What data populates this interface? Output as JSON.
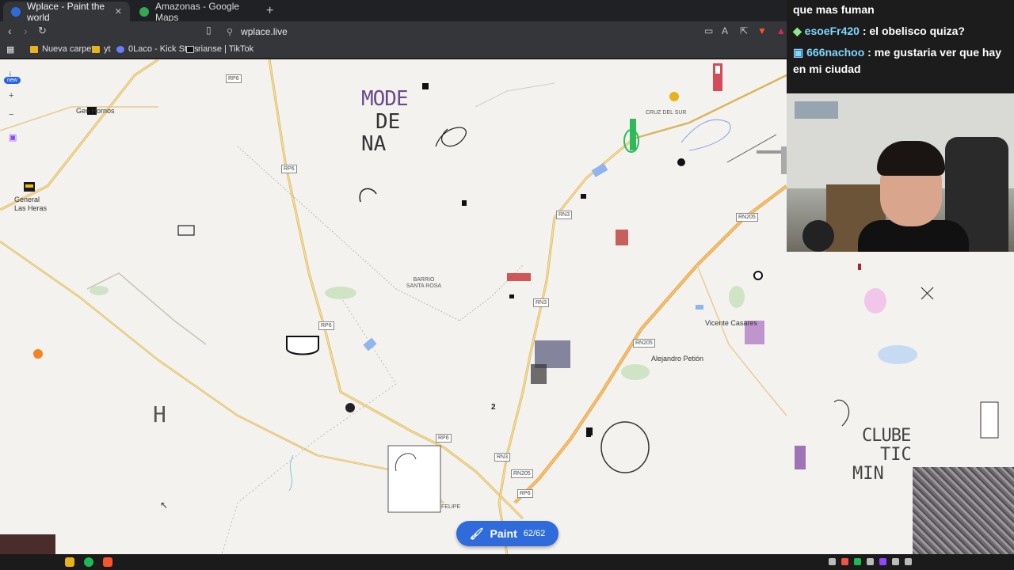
{
  "browser": {
    "tabs": [
      {
        "title": "Wplace - Paint the world",
        "active": true
      },
      {
        "title": "Amazonas - Google Maps",
        "active": false
      }
    ],
    "url": "wplace.live",
    "bookmarks": [
      {
        "label": "Nueva carpeta"
      },
      {
        "label": "yt"
      },
      {
        "label": "0Laco - Kick Stats"
      },
      {
        "label": "rianse | TikTok"
      }
    ]
  },
  "map": {
    "new_badge": "new",
    "road_labels": [
      "RP6",
      "RP6",
      "RP6",
      "RP6",
      "RP6",
      "RP6",
      "RN3",
      "RN3",
      "RN3",
      "RN205",
      "RN205",
      "RN205",
      "RN3"
    ],
    "places": {
      "general_hornos": "Gen Hornos",
      "general_las_heras": "General Las Heras",
      "barrio_santa_rosa": "BARRIO SANTA ROSA",
      "vicente_casares": "Vicente Casares",
      "alejandro_petion": "Alejandro Petión",
      "cruz_del_sur": "CRUZ DEL SUR",
      "felipe": "FELIPE"
    },
    "art_texts": {
      "mode": "MODE",
      "de": "DE",
      "na": "NA",
      "clube": "CLUBE",
      "tic": "TIC",
      "min": "MIN",
      "h": "H",
      "z": "2"
    }
  },
  "paint_button": {
    "label": "Paint",
    "count": "62/62"
  },
  "chat": {
    "messages": [
      {
        "user": "",
        "text": "que mas fuman"
      },
      {
        "user": "esoeFr420",
        "text": ": el obelisco quiza?"
      },
      {
        "user": "666nachoo",
        "text": ": me gustaria ver que hay en mi ciudad"
      }
    ]
  },
  "colors": {
    "paint_button": "#2f6bdb",
    "map_bg": "#f3f2ef",
    "road_main": "#f2d58a",
    "road_border": "#d9b55b"
  }
}
